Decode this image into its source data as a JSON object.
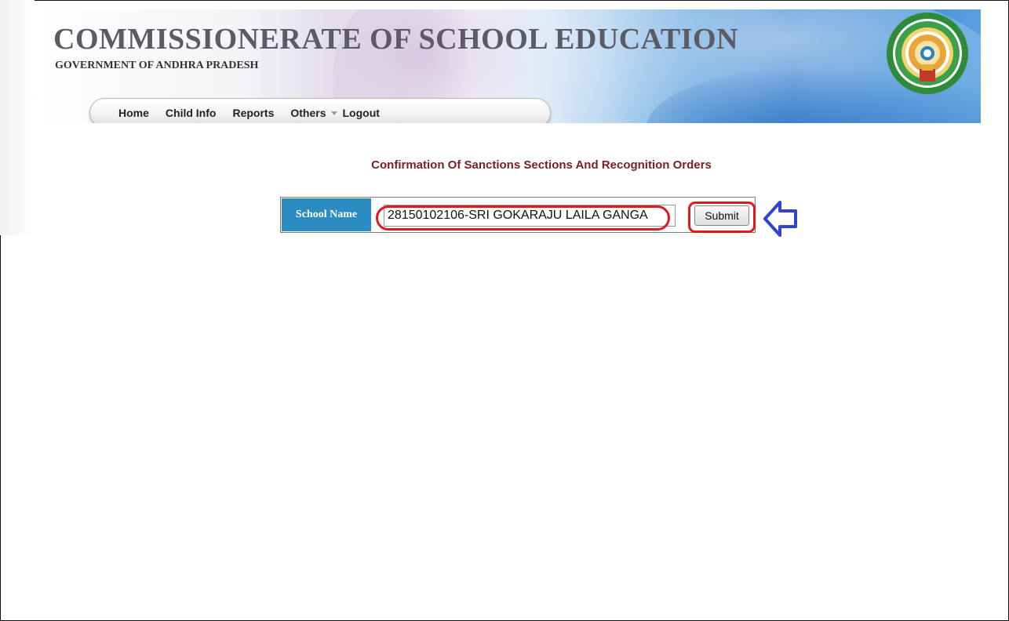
{
  "header": {
    "title": "COMMISSIONERATE OF SCHOOL EDUCATION",
    "subtitle": "GOVERNMENT OF ANDHRA PRADESH",
    "emblem_icon": "andhra-pradesh-emblem"
  },
  "nav": {
    "items": [
      {
        "label": "Home"
      },
      {
        "label": "Child Info"
      },
      {
        "label": "Reports"
      },
      {
        "label": "Others",
        "has_dropdown": true
      },
      {
        "label": "Logout"
      }
    ]
  },
  "main": {
    "heading": "Confirmation Of Sanctions Sections And Recognition Orders",
    "form": {
      "school_label": "School Name",
      "school_value": "28150102106-SRI GOKARAJU LAILA GANGA",
      "submit_label": "Submit"
    }
  },
  "annotations": {
    "highlight_color": "#e01a1a",
    "arrow_color": "#3344cc",
    "arrow_icon": "left-arrow"
  },
  "colors": {
    "heading": "#7a1f1f",
    "label_cell_bg": "#2b8cc4"
  }
}
